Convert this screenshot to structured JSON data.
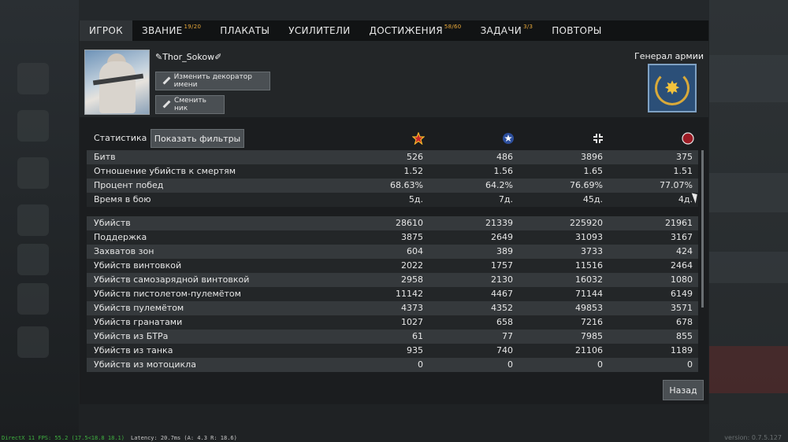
{
  "tabs": [
    {
      "label": "ИГРОК",
      "badge": ""
    },
    {
      "label": "ЗВАНИЕ",
      "badge": "19/20"
    },
    {
      "label": "ПЛАКАТЫ",
      "badge": ""
    },
    {
      "label": "УСИЛИТЕЛИ",
      "badge": ""
    },
    {
      "label": "ДОСТИЖЕНИЯ",
      "badge": "58/60"
    },
    {
      "label": "ЗАДАЧИ",
      "badge": "3/3"
    },
    {
      "label": "ПОВТОРЫ",
      "badge": ""
    }
  ],
  "profile": {
    "nickname": "✎Thor_Sokow✐",
    "decorator_button": "Изменить декоратор имени",
    "change_nick_button": "Сменить ник",
    "rank_title": "Генерал армии"
  },
  "stats": {
    "title": "Статистика",
    "filter_button": "Показать фильтры",
    "column_icons": [
      "star-red-icon",
      "star-blue-icon",
      "cross-icon",
      "circle-red-icon"
    ],
    "colors": {
      "red_star": "#f5b52a",
      "blue_star": "#2c4e9c",
      "circle": "#9b1b24"
    },
    "group1": [
      {
        "label": "Битв",
        "values": [
          "526",
          "486",
          "3896",
          "375"
        ]
      },
      {
        "label": "Отношение убийств к смертям",
        "values": [
          "1.52",
          "1.56",
          "1.65",
          "1.51"
        ]
      },
      {
        "label": "Процент побед",
        "values": [
          "68.63%",
          "64.2%",
          "76.69%",
          "77.07%"
        ]
      },
      {
        "label": "Время в бою",
        "values": [
          "5д.",
          "7д.",
          "45д.",
          "4д."
        ]
      }
    ],
    "group2": [
      {
        "label": "Убийств",
        "values": [
          "28610",
          "21339",
          "225920",
          "21961"
        ]
      },
      {
        "label": "Поддержка",
        "values": [
          "3875",
          "2649",
          "31093",
          "3167"
        ]
      },
      {
        "label": "Захватов зон",
        "values": [
          "604",
          "389",
          "3733",
          "424"
        ]
      },
      {
        "label": "Убийств винтовкой",
        "values": [
          "2022",
          "1757",
          "11516",
          "2464"
        ]
      },
      {
        "label": "Убийств самозарядной винтовкой",
        "values": [
          "2958",
          "2130",
          "16032",
          "1080"
        ]
      },
      {
        "label": "Убийств пистолетом-пулемётом",
        "values": [
          "11142",
          "4467",
          "71144",
          "6149"
        ]
      },
      {
        "label": "Убийств пулемётом",
        "values": [
          "4373",
          "4352",
          "49853",
          "3571"
        ]
      },
      {
        "label": "Убийств гранатами",
        "values": [
          "1027",
          "658",
          "7216",
          "678"
        ]
      },
      {
        "label": "Убийств из БТРа",
        "values": [
          "61",
          "77",
          "7985",
          "855"
        ]
      },
      {
        "label": "Убийств из танка",
        "values": [
          "935",
          "740",
          "21106",
          "1189"
        ]
      },
      {
        "label": "Убийств из мотоцикла",
        "values": [
          "0",
          "0",
          "0",
          "0"
        ]
      }
    ]
  },
  "back_button": "Назад",
  "footer": {
    "fps": "DirectX 11 FPS: 55.2 (17.5<18.8 18.1)",
    "latency": "Latency: 20.7ms (A: 4.3 R: 18.6)",
    "version": "version: 0.7.5.127"
  }
}
